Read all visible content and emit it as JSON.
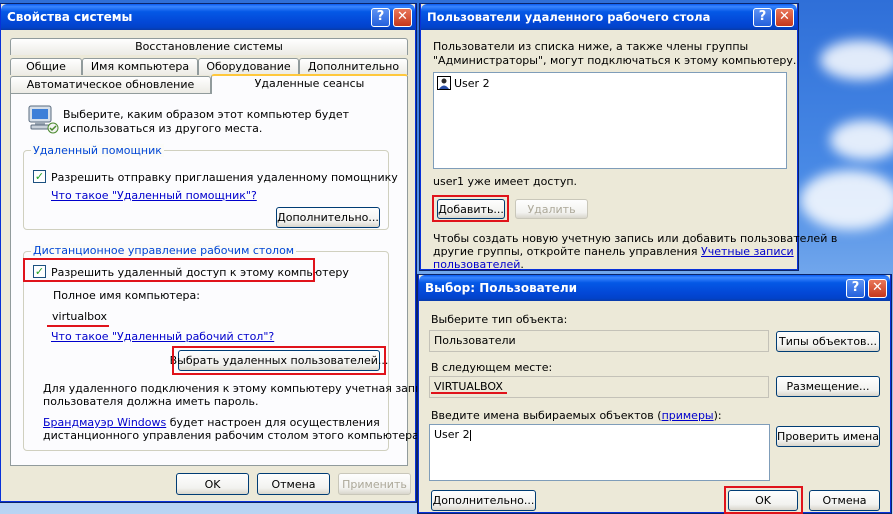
{
  "sysprops": {
    "title": "Свойства системы",
    "tabs_row1": [
      "Восстановление системы"
    ],
    "tabs_row2": [
      "Общие",
      "Имя компьютера",
      "Оборудование",
      "Дополнительно"
    ],
    "tabs_row3": [
      "Автоматическое обновление",
      "Удаленные сеансы"
    ],
    "intro": [
      "Выберите, каким образом этот компьютер будет",
      "использоваться из другого места."
    ],
    "assist_legend": "Удаленный помощник",
    "assist_check": "Разрешить отправку приглашения удаленному помощнику",
    "assist_link": "Что такое \"Удаленный помощник\"?",
    "assist_adv": "Дополнительно...",
    "rdp_legend": "Дистанционное управление рабочим столом",
    "rdp_check": "Разрешить удаленный доступ к этому компьютеру",
    "fullname_label": "Полное имя компьютера:",
    "fullname_value": "virtualbox",
    "rdp_link": "Что такое \"Удаленный рабочий стол\"?",
    "select_users_btn": "Выбрать удаленных пользователей...",
    "note1": [
      "Для удаленного подключения к этому компьютеру учетная запись",
      "пользователя должна иметь пароль."
    ],
    "note2_link": "Брандмауэр Windows",
    "note2_rest": " будет настроен для осуществления",
    "note2_line2": "дистанционного управления рабочим столом этого компьютера.",
    "ok": "OK",
    "cancel": "Отмена",
    "apply": "Применить"
  },
  "rdusers": {
    "title": "Пользователи удаленного рабочего стола",
    "desc": [
      "Пользователи из списка ниже, а также члены группы",
      "\"Администраторы\", могут подключаться к этому компьютеру."
    ],
    "users": [
      "User 2"
    ],
    "access": "user1 уже имеет доступ.",
    "add": "Добавить...",
    "remove": "Удалить",
    "hint1": "Чтобы создать новую учетную запись или добавить пользователей в",
    "hint2_pre": "другие группы, откройте панель управления ",
    "hint2_link": "Учетные записи",
    "hint3_link": "пользователей",
    "hint3_post": "."
  },
  "select": {
    "title": "Выбор: Пользователи",
    "obj_type_label": "Выберите тип объекта:",
    "obj_type_value": "Пользователи",
    "obj_types_btn": "Типы объектов...",
    "location_label": "В следующем месте:",
    "location_value": "VIRTUALBOX",
    "location_btn": "Размещение...",
    "names_label_pre": "Введите имена выбираемых объектов (",
    "names_label_link": "примеры",
    "names_label_post": "):",
    "names_value": "User 2",
    "check_names_btn": "Проверить имена",
    "advanced_btn": "Дополнительно...",
    "ok": "OK",
    "cancel": "Отмена"
  },
  "colors": {
    "accent": "#0458e6",
    "highlight": "#e0131b",
    "link": "#0000cc"
  }
}
